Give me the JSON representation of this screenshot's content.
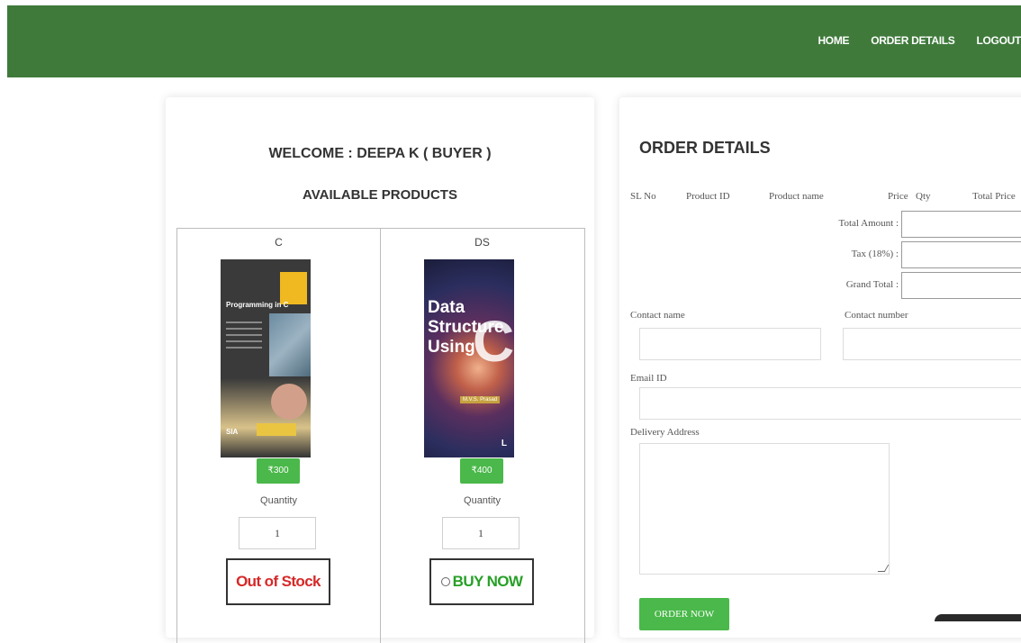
{
  "nav": {
    "home": "HOME",
    "order_details": "ORDER DETAILS",
    "logout": "LOGOUT"
  },
  "left": {
    "welcome": "WELCOME : DEEPA K ( BUYER )",
    "available": "AVAILABLE PRODUCTS",
    "products": [
      {
        "name": "C",
        "price": "₹300",
        "qty_label": "Quantity",
        "qty": "1",
        "action": "Out of Stock",
        "cover_title": "Programming in C",
        "cover_badge": "SIA"
      },
      {
        "name": "DS",
        "price": "₹400",
        "qty_label": "Quantity",
        "qty": "1",
        "action": "BUY NOW",
        "cover_line1": "Data",
        "cover_line2": "Structure",
        "cover_line3": "Using",
        "cover_big": "C",
        "cover_author": "M.V.S. Prasad",
        "cover_logo": "L"
      }
    ]
  },
  "right": {
    "title": "ORDER DETAILS",
    "headers": {
      "sl": "SL No",
      "pid": "Product ID",
      "pname": "Product name",
      "price": "Price",
      "qty": "Qty",
      "total": "Total Price"
    },
    "total_amount": "Total Amount :",
    "tax": "Tax (18%) :",
    "grand_total": "Grand Total :",
    "contact_name": "Contact name",
    "contact_number": "Contact number",
    "email": "Email ID",
    "address": "Delivery Address",
    "order_now": "ORDER NOW"
  },
  "colors": {
    "header": "#3f7a3b",
    "accent": "#4ab84a",
    "danger": "#d62828",
    "success": "#27a027"
  }
}
